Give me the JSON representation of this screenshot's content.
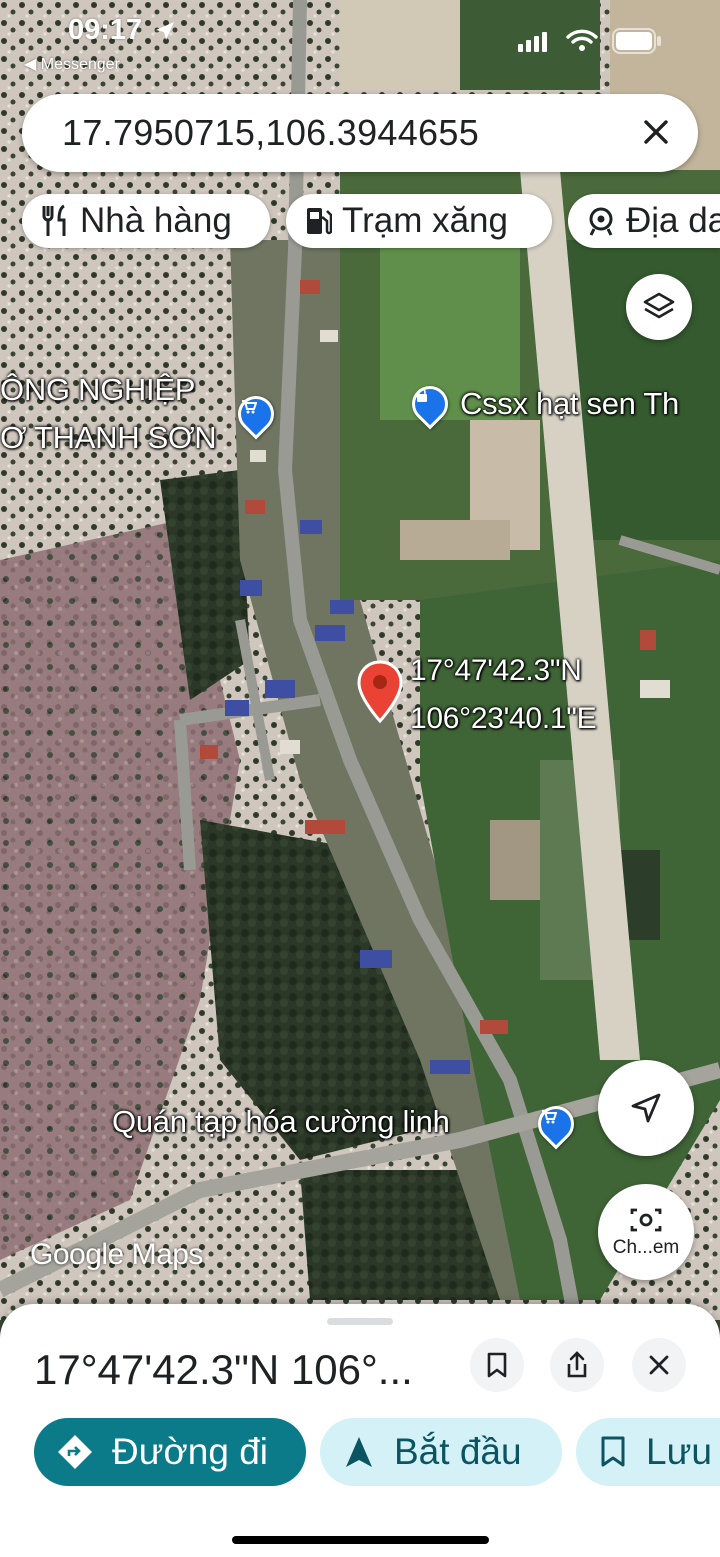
{
  "status_bar": {
    "time": "09:17",
    "back_app": "◀ Messenger"
  },
  "search": {
    "query": "17.7950715,106.3944655",
    "clear_icon": "close-icon"
  },
  "chips": [
    {
      "label": "Nhà hàng",
      "icon": "restaurant-icon"
    },
    {
      "label": "Trạm xăng",
      "icon": "gas-station-icon"
    },
    {
      "label": "Địa da",
      "icon": "landmark-icon"
    }
  ],
  "map": {
    "labels": {
      "poi_left_line1": "ÔNG NGHIỆP",
      "poi_left_line2": "Ơ THANH SƠN",
      "poi_right": "Cssx hạt sen Th",
      "pin_lat": "17°47'42.3\"N",
      "pin_lng": "106°23'40.1\"E",
      "poi_bottom": "Quán tạp hóa cường linh"
    },
    "logo": "Google Maps",
    "colors": {
      "pin": "#ea4335",
      "poi_pin": "#1a73e8"
    }
  },
  "controls": {
    "layers_icon": "layers-icon",
    "location_icon": "my-location-icon",
    "camera_label": "Ch...em"
  },
  "sheet": {
    "title": "17°47'42.3\"N 106°...",
    "buttons": {
      "directions": "Đường đi",
      "start": "Bắt đầu",
      "save": "Lưu"
    },
    "colors": {
      "directions_bg": "#0b7b8a",
      "secondary_bg": "#d4f1f7",
      "secondary_text": "#0b5563"
    }
  }
}
